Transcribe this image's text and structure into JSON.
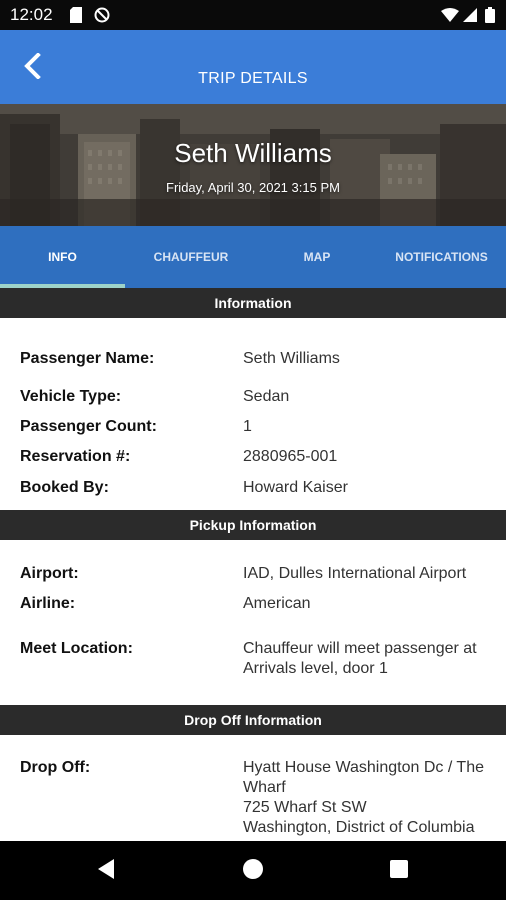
{
  "status_bar": {
    "time": "12:02",
    "icons": [
      "sd-card-icon",
      "no-disturb-icon",
      "wifi-icon",
      "signal-icon",
      "battery-icon"
    ]
  },
  "app_bar": {
    "title": "TRIP DETAILS",
    "back_icon": "back-chevron-icon",
    "color": "#3b7dd8"
  },
  "hero": {
    "passenger_name": "Seth Williams",
    "datetime": "Friday, April 30, 2021 3:15 PM"
  },
  "tabs": [
    {
      "label": "INFO",
      "active": true
    },
    {
      "label": "CHAUFFEUR",
      "active": false
    },
    {
      "label": "MAP",
      "active": false
    },
    {
      "label": "NOTIFICATIONS",
      "active": false
    }
  ],
  "sections": {
    "information": {
      "title": "Information",
      "rows": [
        {
          "label": "Passenger Name:",
          "value": "Seth Williams"
        },
        {
          "label": "Vehicle Type:",
          "value": "Sedan"
        },
        {
          "label": "Passenger Count:",
          "value": "1"
        },
        {
          "label": "Reservation #:",
          "value": "2880965-001"
        },
        {
          "label": "Booked By:",
          "value": "Howard Kaiser"
        }
      ]
    },
    "pickup": {
      "title": "Pickup Information",
      "rows": [
        {
          "label": "Airport:",
          "value": "IAD, Dulles International Airport"
        },
        {
          "label": "Airline:",
          "value": "American"
        },
        {
          "label": "Meet Location:",
          "value": "Chauffeur will meet passenger at\nArrivals level, door 1"
        }
      ]
    },
    "dropoff": {
      "title": "Drop Off Information",
      "rows": [
        {
          "label": "Drop Off:",
          "value": "Hyatt House Washington Dc / The\nWharf\n725 Wharf St SW\nWashington, District of Columbia"
        }
      ]
    }
  },
  "nav_bar": {
    "buttons": [
      "back-triangle-icon",
      "home-circle-icon",
      "recents-square-icon"
    ]
  },
  "colors": {
    "app_bar": "#3b7dd8",
    "tabs": "#2f6fbf",
    "tab_indicator": "#9dd3c9",
    "section_header": "#2b2b2b"
  }
}
